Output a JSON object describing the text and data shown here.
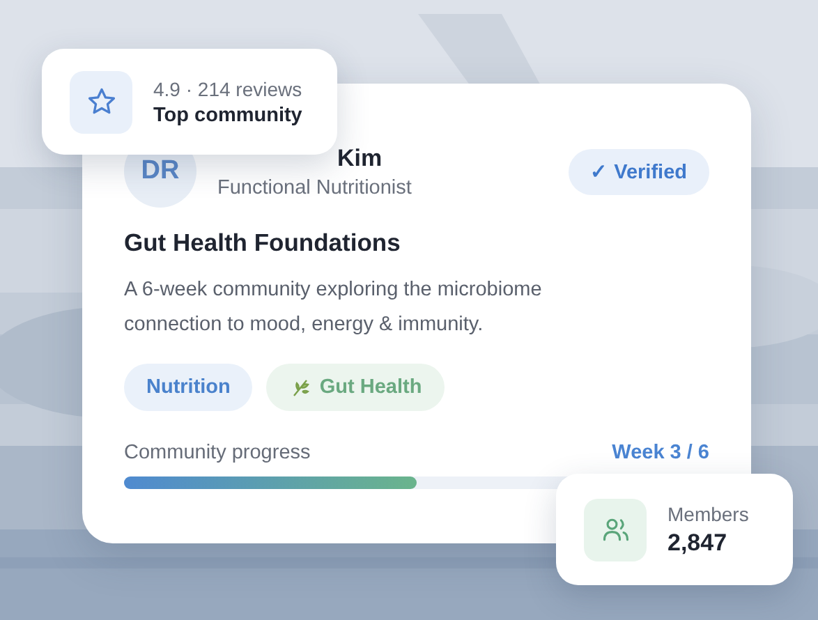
{
  "rating_card": {
    "rating": "4.9 · 214 reviews",
    "label": "Top community"
  },
  "profile": {
    "initials": "DR",
    "name": "Kim",
    "role": "Functional Nutritionist",
    "verified": true,
    "verified_label": "✓ Verified"
  },
  "title": "Gut Health Foundations",
  "description": "A 6-week community exploring the microbiome connection to mood, energy & immunity.",
  "tags": [
    {
      "label": "Nutrition",
      "kind": "plain"
    },
    {
      "label": "Gut Health",
      "kind": "leaf"
    }
  ],
  "progress": {
    "label": "Community progress",
    "reading": "Week 3 / 6",
    "level": 0.5
  },
  "members_card": {
    "label": "Members",
    "count": "2,847"
  }
}
